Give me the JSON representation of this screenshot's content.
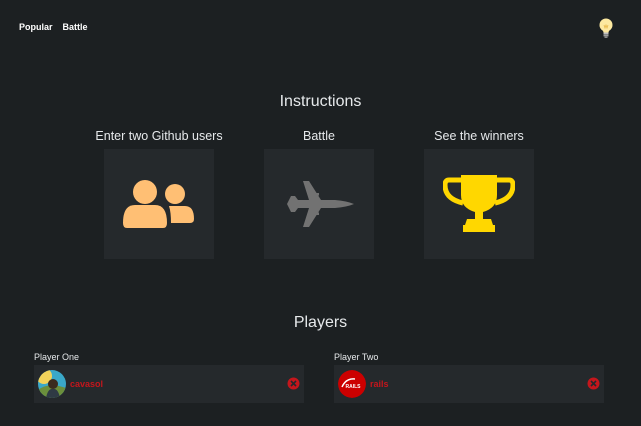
{
  "nav": {
    "popular_label": "Popular",
    "battle_label": "Battle",
    "theme_icon": "lightbulb-icon"
  },
  "instructions": {
    "title": "Instructions",
    "steps": [
      {
        "label": "Enter two Github users",
        "icon": "users-icon",
        "color": "#ffbf74"
      },
      {
        "label": "Battle",
        "icon": "fighter-jet-icon",
        "color": "#727272"
      },
      {
        "label": "See the winners",
        "icon": "trophy-icon",
        "color": "#ffd700"
      }
    ]
  },
  "players": {
    "title": "Players",
    "one": {
      "label": "Player One",
      "username": "cavasol",
      "reset_icon": "close-circle-icon"
    },
    "two": {
      "label": "Player Two",
      "username": "rails",
      "reset_icon": "close-circle-icon",
      "avatar_text": "RAILS"
    }
  },
  "colors": {
    "background": "#1c2022",
    "card": "#25292c",
    "link_red": "#c4161c"
  }
}
